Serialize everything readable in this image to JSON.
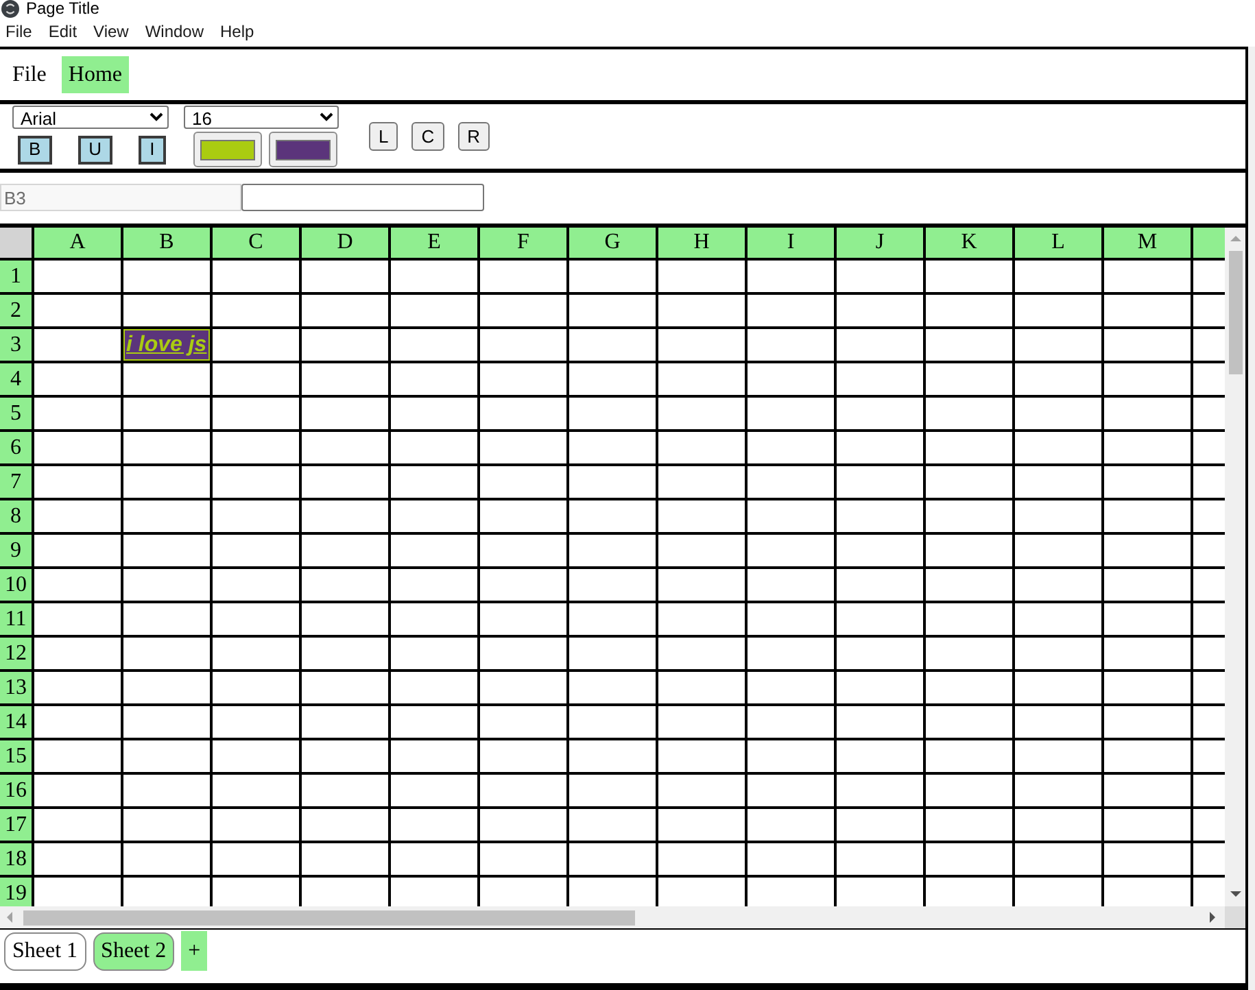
{
  "window": {
    "title": "Page Title"
  },
  "menu_bar": [
    "File",
    "Edit",
    "View",
    "Window",
    "Help"
  ],
  "ribbon_tabs": [
    {
      "label": "File",
      "selected": false
    },
    {
      "label": "Home",
      "selected": true
    }
  ],
  "toolbar": {
    "font_family": "Arial",
    "font_size": "16",
    "style_buttons": [
      {
        "label": "B",
        "active": true
      },
      {
        "label": "U",
        "active": true
      },
      {
        "label": "I",
        "active": true
      }
    ],
    "color_buttons": [
      {
        "color": "#aacc11"
      },
      {
        "color": "#5b347b"
      }
    ],
    "align_buttons": [
      {
        "label": "L",
        "active": false
      },
      {
        "label": "C",
        "active": false
      },
      {
        "label": "R",
        "active": false
      }
    ]
  },
  "formula_bar": {
    "cell_ref": "B3"
  },
  "sheet": {
    "columns": [
      "A",
      "B",
      "C",
      "D",
      "E",
      "F",
      "G",
      "H",
      "I",
      "J",
      "K",
      "L",
      "M"
    ],
    "rows": [
      {
        "label": "1"
      },
      {
        "label": "2"
      },
      {
        "label": "3",
        "cells": [
          {
            "kind": "blank"
          },
          {
            "kind": "text",
            "text": "i love js",
            "bold": true,
            "italic": true,
            "underline": true,
            "font": {
              "color": "#aacc11"
            },
            "fill": {
              "color": "#5b347b"
            }
          }
        ]
      },
      {
        "label": "4"
      },
      {
        "label": "5"
      },
      {
        "label": "6"
      },
      {
        "label": "7"
      },
      {
        "label": "8"
      },
      {
        "label": "9"
      },
      {
        "label": "10"
      },
      {
        "label": "11"
      },
      {
        "label": "12"
      },
      {
        "label": "13"
      },
      {
        "label": "14"
      },
      {
        "label": "15"
      },
      {
        "label": "16"
      },
      {
        "label": "17"
      },
      {
        "label": "18"
      },
      {
        "label": "19"
      }
    ]
  },
  "sheet_tabs": [
    {
      "label": "Sheet 1",
      "selected": false
    },
    {
      "label": "Sheet 2",
      "selected": true
    }
  ],
  "add_sheet": "+"
}
